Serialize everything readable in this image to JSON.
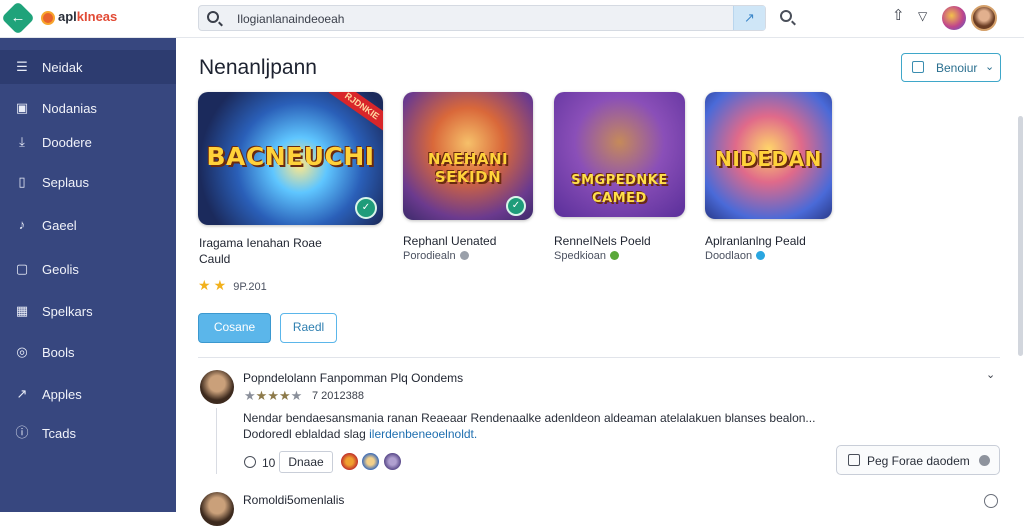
{
  "topbar": {
    "brand_prefix": "apl",
    "brand_suffix": "kIneas",
    "back_glyph": "←",
    "search_value": "Ilogianlanaindeoeah",
    "search_action_glyph": "↗"
  },
  "sidebar": {
    "items": [
      {
        "label": "Neidak",
        "icon": "list-icon",
        "glyph": "☰"
      },
      {
        "label": "Nodanias",
        "icon": "image-icon",
        "glyph": "▣"
      },
      {
        "label": "Doodere",
        "icon": "download-icon",
        "glyph": "⤓"
      },
      {
        "label": "Seplaus",
        "icon": "document-icon",
        "glyph": "▯"
      },
      {
        "label": "Gaeel",
        "icon": "music-icon",
        "glyph": "♪"
      },
      {
        "label": "Geolis",
        "icon": "bag-icon",
        "glyph": "▢"
      },
      {
        "label": "Spelkars",
        "icon": "grid-icon",
        "glyph": "▦"
      },
      {
        "label": "Bools",
        "icon": "circle-icon",
        "glyph": "◎"
      },
      {
        "label": "Apples",
        "icon": "chart-icon",
        "glyph": "↗"
      },
      {
        "label": "Tcads",
        "icon": "info-icon",
        "glyph": "ⓘ"
      }
    ]
  },
  "main": {
    "title": "Nenanljpann",
    "sort_label": "Benoiur",
    "games": [
      {
        "art_text": "BACNEUCHI",
        "ribbon": "RJDNKIE",
        "title_line1": "Iragama Ienahan Roae",
        "title_line2": "Cauld",
        "sub": ""
      },
      {
        "art_text": "NAEHANI SEKIDN",
        "title_line1": "Rephanl Uenated",
        "sub": "Porodiealn"
      },
      {
        "art_text": "SMGPEDNKE CAMED",
        "title_line1": "RenneINels Poeld",
        "sub": "Spedkioan"
      },
      {
        "art_text": "NIDEDAN",
        "title_line1": "Aplranlanlng Peald",
        "sub": "Doodlaon"
      }
    ],
    "rating_text": "9P.201",
    "primary_button": "Cosane",
    "secondary_button": "Raedl"
  },
  "review": {
    "name": "Popndelolann Fanpomman Plq Oondems",
    "date": "7 2012388",
    "body_line1": "Nendar bendaesansmania ranan Reaeaar Rendenaalke adenldeon aldeaman atelalakuen blanses bealon...",
    "body_line2_plain": "Dodoredl eblaldad slag",
    "body_line2_link": "ilerdenbeneoelnoldt.",
    "like_count": "10",
    "reply_label": "Dnaae",
    "report_label": "Peg Forae daodem",
    "next_name": "Romoldi5omenlalis"
  },
  "colors": {
    "sidebar_bg": "#37477f",
    "accent": "#5bb6ea",
    "brand_green": "#1fa37a"
  }
}
